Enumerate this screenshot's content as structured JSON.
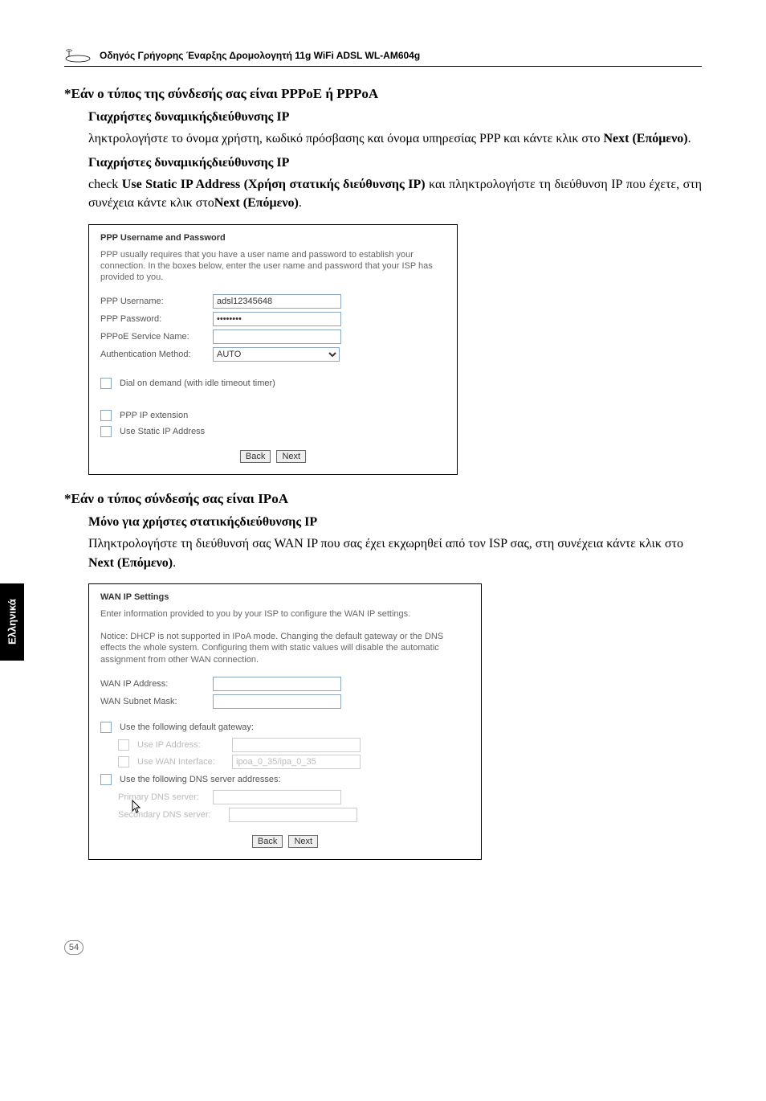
{
  "header": {
    "title": "Οδηγός Γρήγορης Έναρξης Δρομολογητή 11g WiFi ADSL WL-AM604g"
  },
  "section1": {
    "heading": "*Εάν ο τύπος της σύνδεσής σας είναι PPPoE ή PPPoA",
    "sub1": "Γιαχρήστες δυναμικήςδιεύθυνσης ΙΡ",
    "para1": "ληκτρολογήστε το όνομα χρήστη, κωδικό πρόσβασης και όνομα υπηρεσίας PPP και κάντε κλικ στο ",
    "para1_bold": "Next (Επόμενο)",
    "para1_end": ".",
    "sub2": "Γιαχρήστες δυναμικήςδιεύθυνσης ΙΡ",
    "para2_a": "check ",
    "para2_bold1": "Use Static IP Address (Χρήση στατικής διεύθυνσης ΙΡ)",
    "para2_b": " και πληκτρολογήστε τη διεύθυνση ΙΡ που έχετε, στη συνέχεια κάντε κλικ στο",
    "para2_bold2": "Next (Επόμενο)",
    "para2_end": "."
  },
  "sc1": {
    "title": "PPP Username and Password",
    "desc": "PPP usually requires that you have a user name and password to establish your connection. In the boxes below, enter the user name and password that your ISP has provided to you.",
    "l_user": "PPP Username:",
    "v_user": "adsl12345648",
    "l_pass": "PPP Password:",
    "v_pass": "••••••••",
    "l_svc": "PPPoE Service Name:",
    "l_auth": "Authentication Method:",
    "v_auth": "AUTO",
    "chk1": "Dial on demand (with idle timeout timer)",
    "chk2": "PPP IP extension",
    "chk3": "Use Static IP Address",
    "btn_back": "Back",
    "btn_next": "Next"
  },
  "section2": {
    "heading": "*Εάν ο τύπος σύνδεσής σας είναι IPoA",
    "sub1": "Μόνο για χρήστες στατικήςδιεύθυνσης ΙΡ",
    "para1_a": "Πληκτρολογήστε τη διεύθυνσή σας WAN IP που σας έχει εκχωρηθεί από τον ISP σας, στη συνέχεια κάντε κλικ στο ",
    "para1_bold": "Next (Επόμενο)",
    "para1_end": "."
  },
  "sc2": {
    "title": "WAN IP Settings",
    "desc1": "Enter information provided to you by your ISP to configure the WAN IP settings.",
    "desc2": "Notice: DHCP is not supported in IPoA mode. Changing the default gateway or the DNS effects the whole system. Configuring them with static values will disable the automatic assignment from other WAN connection.",
    "l_wanip": "WAN IP Address:",
    "l_mask": "WAN Subnet Mask:",
    "chk_gw": "Use the following default gateway:",
    "chk_gw_ip": "Use IP Address:",
    "chk_gw_wan": "Use WAN Interface:",
    "v_gw_wan": "ipoa_0_35/ipa_0_35",
    "chk_dns": "Use the following DNS server addresses:",
    "l_dns1": "Primary DNS server:",
    "l_dns2": "Secondary DNS server:",
    "btn_back": "Back",
    "btn_next": "Next"
  },
  "sidebar": {
    "label": "Ελληνικά"
  },
  "footer": {
    "page": "54"
  }
}
